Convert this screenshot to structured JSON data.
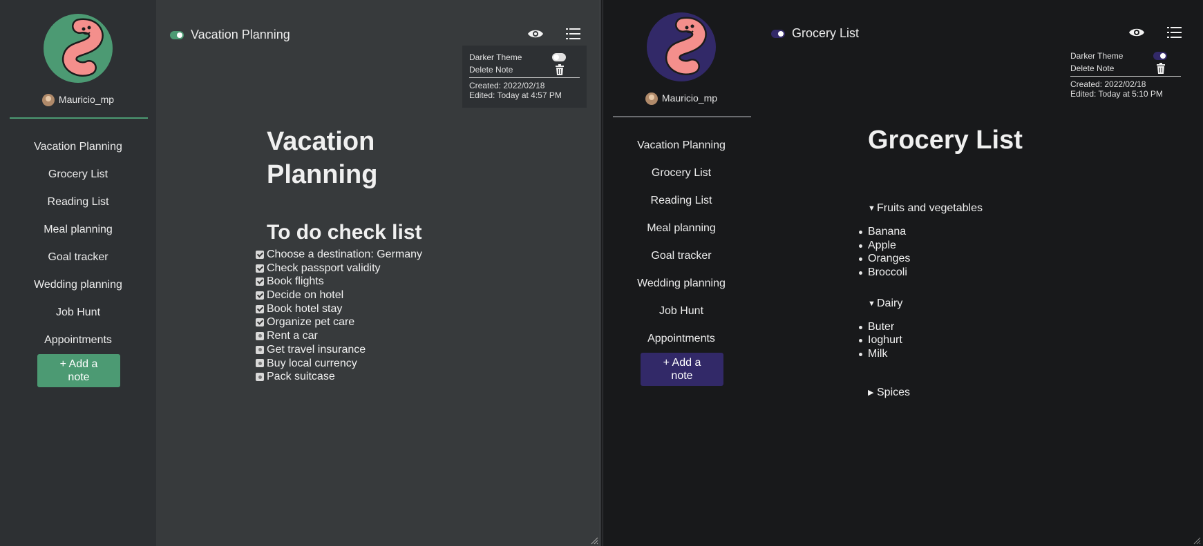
{
  "left": {
    "accent": "#4c9a73",
    "username": "Mauricio_mp",
    "nav": [
      "Vacation Planning",
      "Grocery List",
      "Reading List",
      "Meal planning",
      "Goal tracker",
      "Wedding planning",
      "Job Hunt",
      "Appointments"
    ],
    "add_note_line1": "+ Add a",
    "add_note_line2": "note",
    "note_title": "Vacation Planning",
    "menu": {
      "darker_theme": "Darker Theme",
      "darker_theme_on": false,
      "delete_note": "Delete Note",
      "created": "Created: 2022/02/18",
      "edited": "Edited: Today at 4:57 PM"
    },
    "doc": {
      "heading_line1": "Vacation",
      "heading_line2": "Planning",
      "subheading": "To do check list",
      "tasks": [
        {
          "text": "Choose a destination: Germany",
          "checked": true
        },
        {
          "text": "Check passport validity",
          "checked": true
        },
        {
          "text": "Book flights",
          "checked": true
        },
        {
          "text": "Decide on hotel",
          "checked": true
        },
        {
          "text": "Book hotel stay",
          "checked": true
        },
        {
          "text": "Organize pet care",
          "checked": true
        },
        {
          "text": "Rent a car",
          "checked": false
        },
        {
          "text": "Get travel insurance",
          "checked": false
        },
        {
          "text": "Buy local currency",
          "checked": false
        },
        {
          "text": "Pack suitcase",
          "checked": false
        }
      ]
    }
  },
  "right": {
    "accent": "#322968",
    "username": "Mauricio_mp",
    "nav": [
      "Vacation Planning",
      "Grocery List",
      "Reading List",
      "Meal planning",
      "Goal tracker",
      "Wedding planning",
      "Job Hunt",
      "Appointments"
    ],
    "add_note_line1": "+ Add a",
    "add_note_line2": "note",
    "note_title": "Grocery List",
    "menu": {
      "darker_theme": "Darker Theme",
      "darker_theme_on": true,
      "delete_note": "Delete Note",
      "created": "Created: 2022/02/18",
      "edited": "Edited: Today at 5:10 PM"
    },
    "doc": {
      "heading": "Grocery List",
      "sections": [
        {
          "label": "Fruits and vegetables",
          "open": true,
          "items": [
            "Banana",
            "Apple",
            "Oranges",
            "Broccoli"
          ]
        },
        {
          "label": "Dairy",
          "open": true,
          "items": [
            "Buter",
            "Ioghurt",
            "Milk"
          ]
        },
        {
          "label": "Spices",
          "open": false,
          "items": []
        }
      ]
    }
  },
  "icons": {
    "preview": "eye-icon",
    "outline": "list-icon",
    "delete": "trash-icon"
  }
}
